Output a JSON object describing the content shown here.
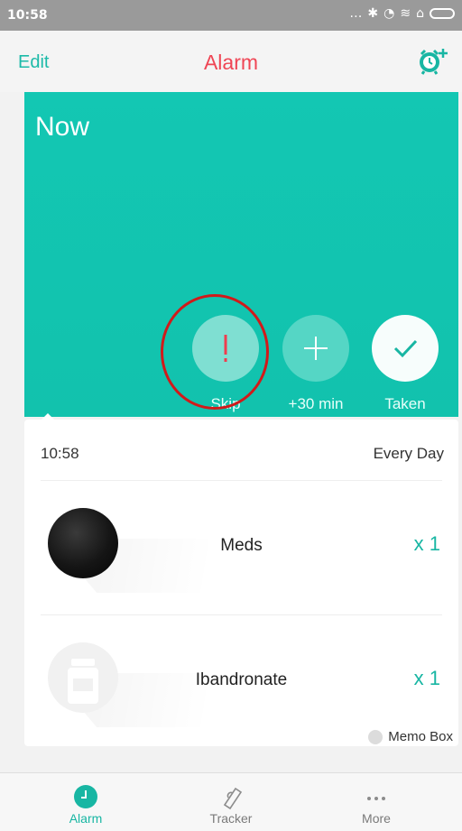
{
  "status": {
    "time": "10:58"
  },
  "header": {
    "edit": "Edit",
    "title": "Alarm"
  },
  "hero": {
    "label": "Now"
  },
  "actions": {
    "skip": "Skip",
    "snooze": "+30 min",
    "taken": "Taken"
  },
  "schedule": {
    "time": "10:58",
    "repeat": "Every Day"
  },
  "meds": [
    {
      "name": "Meds",
      "qty": "x 1"
    },
    {
      "name": "Ibandronate",
      "qty": "x 1"
    }
  ],
  "memo": "Memo Box",
  "tabs": {
    "alarm": "Alarm",
    "tracker": "Tracker",
    "more": "More"
  },
  "icons": {
    "add_alarm": "alarm-clock-plus-icon",
    "skip": "exclamation-icon",
    "snooze": "plus-icon",
    "taken": "checkmark-icon",
    "tab_alarm": "clock-icon",
    "tab_tracker": "clipboard-icon",
    "tab_more": "more-dots-icon"
  },
  "colors": {
    "accent": "#18b6a3",
    "title": "#ef4655",
    "hero": "#13c7b3",
    "highlight": "#d11a1a"
  }
}
